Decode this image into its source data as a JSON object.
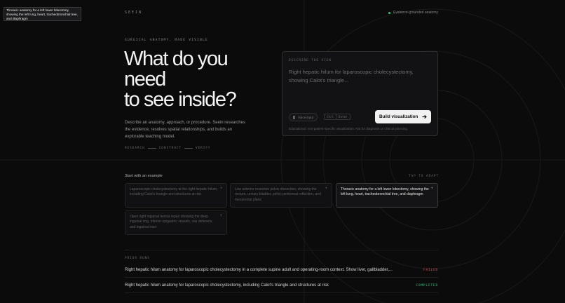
{
  "tooltip": "Thoracic anatomy for a left lower lobectomy, showing the left lung, heart, tracheobronchial tree, and diaphragm",
  "header": {
    "brand": "SEEIN",
    "status": "Evidence-grounded anatomy",
    "status_color": "#36c77a"
  },
  "hero": {
    "eyebrow": "SURGICAL ANATOMY, MADE VISIBLE",
    "line1": "What do you",
    "line2": "need",
    "line3": "to see inside?",
    "description": "Describe an anatomy, approach, or procedure. Seein researches the evidence, resolves spatial relationships, and builds an explorable teaching model.",
    "steps": [
      "RESEARCH",
      "CONSTRUCT",
      "VERIFY"
    ]
  },
  "composer": {
    "label": "DESCRIBE THE VIEW",
    "placeholder": "Right hepatic hilum for laparoscopic cholecystectomy, showing Calot's triangle...",
    "voice_label": "Voice input",
    "kbd1": "Ctrl",
    "kbd2": "Enter",
    "submit_label": "Build visualization",
    "submit_icon": "arrow-right-icon",
    "disclaimer": "Educational, non-patient-specific visualization. Not for diagnosis or clinical planning."
  },
  "examples": {
    "title": "Start with an example",
    "hint": "TAP TO ADAPT",
    "items": [
      "Laparoscopic cholecystectomy at the right hepatic hilum, including Calot's triangle and structures at risk",
      "Low anterior resection pelvic dissection, showing the rectum, urinary bladder, pelvic peritoneal reflection, and mesorectal plane",
      "Thoracic anatomy for a left lower lobectomy, showing the left lung, heart, tracheobronchial tree, and diaphragm",
      "Open right inguinal hernia repair showing the deep inguinal ring, inferior epigastric vessels, vas deferens, and inguinal tract"
    ]
  },
  "prior_runs": {
    "label": "PRIOR RUNS",
    "items": [
      {
        "text": "Right hepatic hilum anatomy for laparoscopic cholecystectomy in a complete supine adult and operating-room context. Show liver, gallbladder,...",
        "status": "FAILED",
        "color": "#e0524f"
      },
      {
        "text": "Right hepatic hilum anatomy for laparoscopic cholecystectomy, including Calot's triangle and structures at risk",
        "status": "COMPLETED",
        "color": "#36c77a"
      }
    ]
  }
}
